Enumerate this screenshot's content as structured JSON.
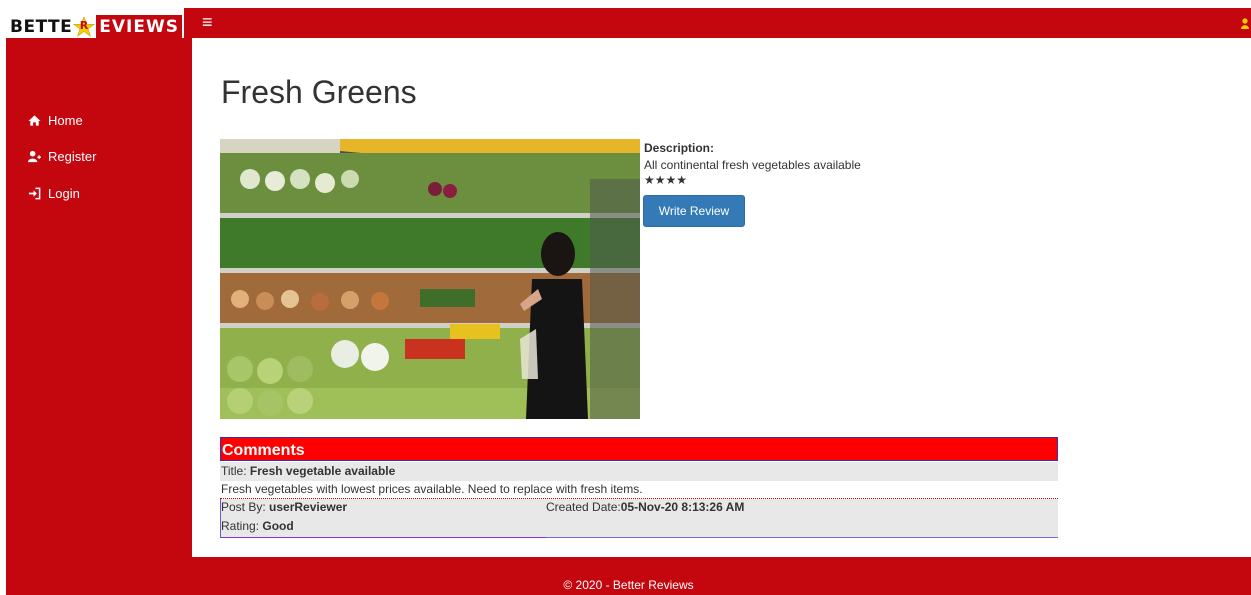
{
  "brand": {
    "part1": "BETTE",
    "star_letter": "R",
    "part2": "EVIEWS"
  },
  "header": {
    "menu_icon": "hamburger-icon",
    "user_icon": "user-icon"
  },
  "sidebar": {
    "items": [
      {
        "label": "Home",
        "icon": "home-icon"
      },
      {
        "label": "Register",
        "icon": "user-plus-icon"
      },
      {
        "label": "Login",
        "icon": "sign-in-icon"
      }
    ]
  },
  "main": {
    "title": "Fresh Greens",
    "description_label": "Description:",
    "description_text": "All continental fresh vegetables available",
    "rating_stars": 4,
    "stars_text": "★★★★",
    "write_review_label": "Write Review"
  },
  "comments": {
    "heading": "Comments",
    "items": [
      {
        "title_label": "Title: ",
        "title": "Fresh vegetable available",
        "body": "Fresh vegetables with lowest prices available. Need to replace with fresh items.",
        "post_by_label": "Post By: ",
        "post_by": "userReviewer",
        "created_label": "Created Date:",
        "created": "05-Nov-20 8:13:26 AM",
        "rating_label": "Rating: ",
        "rating": "Good"
      }
    ]
  },
  "footer": {
    "text": "© 2020 - Better Reviews"
  },
  "colors": {
    "brand_red": "#c4070f",
    "comments_header": "#ff0000",
    "button_blue": "#337ab7"
  }
}
